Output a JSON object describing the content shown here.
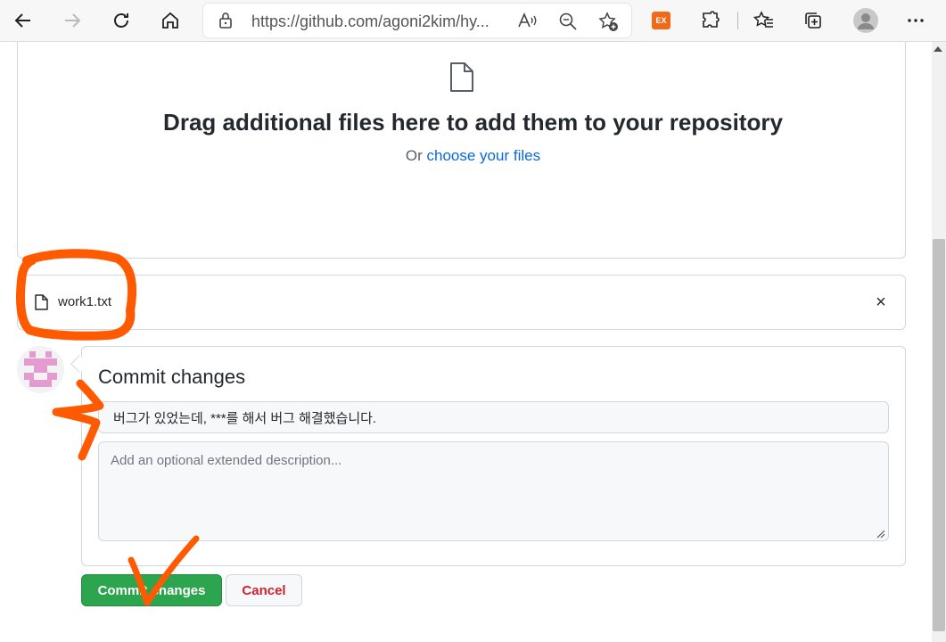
{
  "browser": {
    "url": "https://github.com/agoni2kim/hy...",
    "extension_badge": "EX"
  },
  "dropzone": {
    "title": "Drag additional files here to add them to your repository",
    "or_text": "Or",
    "choose_link": "choose your files"
  },
  "file": {
    "name": "work1.txt",
    "remove_glyph": "×"
  },
  "commit": {
    "heading": "Commit changes",
    "summary_value": "버그가 있었는데, ***를 해서 버그 해결했습니다.",
    "description_placeholder": "Add an optional extended description...",
    "commit_button": "Commit changes",
    "cancel_button": "Cancel"
  },
  "colors": {
    "commit_button": "#2da44e",
    "cancel_text": "#cf222e",
    "link": "#0969da",
    "annotation": "#ff5a00"
  }
}
